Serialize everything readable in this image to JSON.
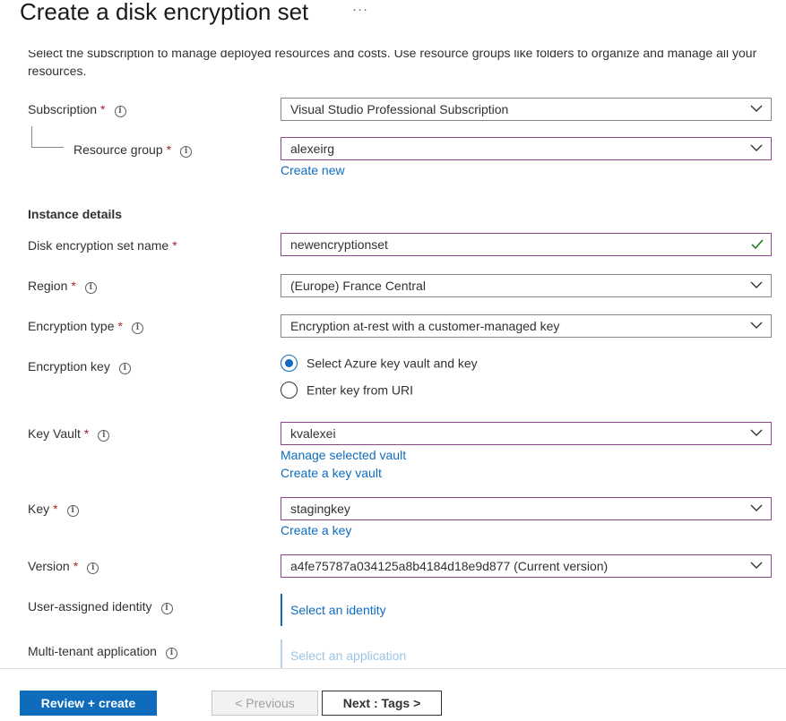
{
  "page": {
    "title": "Create a disk encryption set",
    "more": "···",
    "intro_text": "Select the subscription to manage deployed resources and costs. Use resource groups like folders to organize and manage all your resources."
  },
  "subscription": {
    "label": "Subscription",
    "required": "*",
    "value": "Visual Studio Professional Subscription"
  },
  "resource_group": {
    "label": "Resource group",
    "required": "*",
    "value": "alexeirg",
    "create_new": "Create new"
  },
  "instance_details": {
    "heading": "Instance details"
  },
  "encryption_set_name": {
    "label": "Disk encryption set name",
    "required": "*",
    "value": "newencryptionset"
  },
  "region": {
    "label": "Region",
    "required": "*",
    "value": "(Europe) France Central"
  },
  "encryption_type": {
    "label": "Encryption type",
    "required": "*",
    "value": "Encryption at-rest with a customer-managed key"
  },
  "encryption_key": {
    "label": "Encryption key",
    "options": [
      {
        "label": "Select Azure key vault and key",
        "selected": true
      },
      {
        "label": "Enter key from URI",
        "selected": false
      }
    ]
  },
  "key_vault": {
    "label": "Key Vault",
    "required": "*",
    "value": "kvalexei",
    "manage_link": "Manage selected vault",
    "create_link": "Create a key vault"
  },
  "key": {
    "label": "Key",
    "required": "*",
    "value": "stagingkey",
    "create_link": "Create a key"
  },
  "version": {
    "label": "Version",
    "required": "*",
    "value": "a4fe75787a034125a8b4184d18e9d877 (Current version)"
  },
  "identity": {
    "label": "User-assigned identity",
    "link": "Select an identity"
  },
  "application": {
    "label": "Multi-tenant application",
    "link": "Select an application"
  },
  "footer": {
    "review_create": "Review + create",
    "previous": "< Previous",
    "next": "Next : Tags >"
  },
  "icons": {
    "info": "info-icon",
    "dropdown": "chevron-down-icon",
    "valid": "checkmark-icon"
  },
  "colors": {
    "accent": "#0f6cbd",
    "required": "#a4262c",
    "active_border": "#8b4789",
    "valid": "#107c10"
  }
}
